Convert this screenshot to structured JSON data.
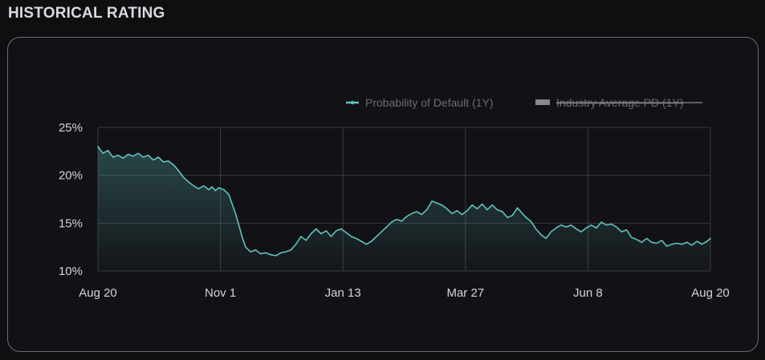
{
  "header": {
    "title": "HISTORICAL RATING"
  },
  "colors": {
    "background": "#0f0f12",
    "card_border": "#6a6b70",
    "grid": "#3a3b40",
    "series_line": "#5fc3bd",
    "legend_text": "#6b6b70",
    "legend_disabled": "#9a9a9e",
    "tick_text": "#d4d4d8"
  },
  "chart_data": {
    "type": "area",
    "title": "",
    "xlabel": "",
    "ylabel": "",
    "x_ticks": [
      "Aug 20",
      "Nov 1",
      "Jan 13",
      "Mar 27",
      "Jun 8",
      "Aug 20"
    ],
    "y_ticks": [
      "25%",
      "20%",
      "15%",
      "10%"
    ],
    "ylim": [
      10,
      25
    ],
    "y_unit": "%",
    "grid": true,
    "legend_position": "top-right",
    "legend": [
      {
        "name": "Probability of Default (1Y)",
        "marker": "line",
        "color": "#5fc3bd",
        "disabled": false
      },
      {
        "name": "Industry Average PD (1Y)",
        "marker": "rect",
        "color": "#9a9a9e",
        "disabled": true
      }
    ],
    "series": [
      {
        "name": "Probability of Default (1Y)",
        "x_domain": [
          0,
          365
        ],
        "points": [
          [
            0,
            23.0
          ],
          [
            3,
            22.3
          ],
          [
            6,
            22.6
          ],
          [
            9,
            21.9
          ],
          [
            12,
            22.1
          ],
          [
            15,
            21.8
          ],
          [
            18,
            22.2
          ],
          [
            21,
            22.0
          ],
          [
            24,
            22.3
          ],
          [
            27,
            21.9
          ],
          [
            30,
            22.1
          ],
          [
            33,
            21.6
          ],
          [
            36,
            21.9
          ],
          [
            39,
            21.4
          ],
          [
            42,
            21.5
          ],
          [
            45,
            21.1
          ],
          [
            48,
            20.5
          ],
          [
            51,
            19.8
          ],
          [
            54,
            19.3
          ],
          [
            57,
            18.9
          ],
          [
            60,
            18.6
          ],
          [
            63,
            18.9
          ],
          [
            66,
            18.5
          ],
          [
            68,
            18.8
          ],
          [
            70,
            18.4
          ],
          [
            72,
            18.7
          ],
          [
            75,
            18.5
          ],
          [
            78,
            18.0
          ],
          [
            80,
            17.0
          ],
          [
            82,
            16.0
          ],
          [
            84,
            14.8
          ],
          [
            86,
            13.5
          ],
          [
            88,
            12.5
          ],
          [
            91,
            12.0
          ],
          [
            94,
            12.2
          ],
          [
            97,
            11.8
          ],
          [
            100,
            11.9
          ],
          [
            103,
            11.7
          ],
          [
            106,
            11.6
          ],
          [
            109,
            11.9
          ],
          [
            112,
            12.0
          ],
          [
            115,
            12.2
          ],
          [
            118,
            12.8
          ],
          [
            121,
            13.6
          ],
          [
            124,
            13.2
          ],
          [
            127,
            13.9
          ],
          [
            130,
            14.4
          ],
          [
            133,
            13.9
          ],
          [
            136,
            14.2
          ],
          [
            139,
            13.6
          ],
          [
            142,
            14.2
          ],
          [
            145,
            14.4
          ],
          [
            148,
            14.0
          ],
          [
            151,
            13.6
          ],
          [
            154,
            13.4
          ],
          [
            157,
            13.1
          ],
          [
            160,
            12.8
          ],
          [
            163,
            13.1
          ],
          [
            166,
            13.6
          ],
          [
            169,
            14.1
          ],
          [
            172,
            14.6
          ],
          [
            175,
            15.1
          ],
          [
            178,
            15.4
          ],
          [
            181,
            15.2
          ],
          [
            184,
            15.7
          ],
          [
            187,
            16.0
          ],
          [
            190,
            16.2
          ],
          [
            193,
            15.9
          ],
          [
            196,
            16.4
          ],
          [
            199,
            17.3
          ],
          [
            202,
            17.1
          ],
          [
            205,
            16.9
          ],
          [
            208,
            16.5
          ],
          [
            211,
            16.0
          ],
          [
            214,
            16.3
          ],
          [
            217,
            15.9
          ],
          [
            220,
            16.3
          ],
          [
            223,
            16.9
          ],
          [
            226,
            16.5
          ],
          [
            229,
            17.0
          ],
          [
            232,
            16.4
          ],
          [
            235,
            16.9
          ],
          [
            238,
            16.4
          ],
          [
            241,
            16.2
          ],
          [
            244,
            15.6
          ],
          [
            247,
            15.8
          ],
          [
            250,
            16.6
          ],
          [
            252,
            16.2
          ],
          [
            255,
            15.6
          ],
          [
            258,
            15.2
          ],
          [
            261,
            14.4
          ],
          [
            264,
            13.8
          ],
          [
            267,
            13.4
          ],
          [
            270,
            14.1
          ],
          [
            273,
            14.5
          ],
          [
            276,
            14.8
          ],
          [
            279,
            14.6
          ],
          [
            282,
            14.8
          ],
          [
            285,
            14.4
          ],
          [
            288,
            14.1
          ],
          [
            291,
            14.5
          ],
          [
            294,
            14.8
          ],
          [
            297,
            14.5
          ],
          [
            300,
            15.1
          ],
          [
            303,
            14.8
          ],
          [
            306,
            14.9
          ],
          [
            309,
            14.6
          ],
          [
            312,
            14.1
          ],
          [
            315,
            14.3
          ],
          [
            318,
            13.5
          ],
          [
            321,
            13.3
          ],
          [
            324,
            13.0
          ],
          [
            327,
            13.4
          ],
          [
            330,
            13.0
          ],
          [
            333,
            12.9
          ],
          [
            336,
            13.2
          ],
          [
            339,
            12.6
          ],
          [
            342,
            12.8
          ],
          [
            345,
            12.9
          ],
          [
            348,
            12.8
          ],
          [
            351,
            13.0
          ],
          [
            354,
            12.7
          ],
          [
            357,
            13.1
          ],
          [
            360,
            12.8
          ],
          [
            363,
            13.1
          ],
          [
            365,
            13.4
          ]
        ]
      },
      {
        "name": "Industry Average PD (1Y)",
        "hidden": true,
        "points": []
      }
    ]
  }
}
